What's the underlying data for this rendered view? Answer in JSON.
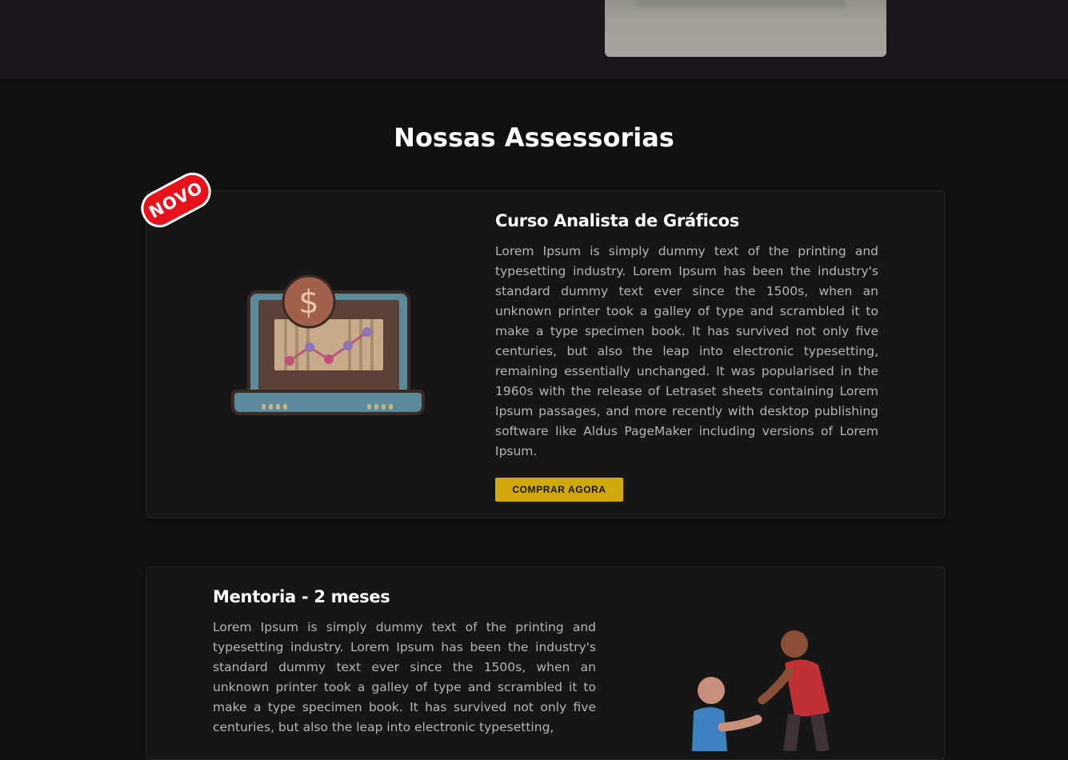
{
  "section": {
    "title": "Nossas Assessorias"
  },
  "cards": [
    {
      "badge": "NOVO",
      "title": "Curso Analista de Gráficos",
      "description": "Lorem Ipsum is simply dummy text of the printing and typesetting industry. Lorem Ipsum has been the industry's standard dummy text ever since the 1500s, when an unknown printer took a galley of type and scrambled it to make a type specimen book. It has survived not only five centuries, but also the leap into electronic typesetting, remaining essentially unchanged. It was popularised in the 1960s with the release of Letraset sheets containing Lorem Ipsum passages, and more recently with desktop publishing software like Aldus PageMaker including versions of Lorem Ipsum.",
      "button_label": "COMPRAR AGORA",
      "icon": "laptop-chart-dollar-icon"
    },
    {
      "title": "Mentoria - 2 meses",
      "description": "Lorem Ipsum is simply dummy text of the printing and typesetting industry. Lorem Ipsum has been the industry's standard dummy text ever since the 1500s, when an unknown printer took a galley of type and scrambled it to make a type specimen book. It has survived not only five centuries, but also the leap into electronic typesetting,",
      "icon": "mentoring-people-icon"
    }
  ],
  "colors": {
    "background": "#111111",
    "card_background": "#161616",
    "badge": "#e8131a",
    "button": "#d2a90b",
    "text_muted": "#b4b4b4"
  }
}
